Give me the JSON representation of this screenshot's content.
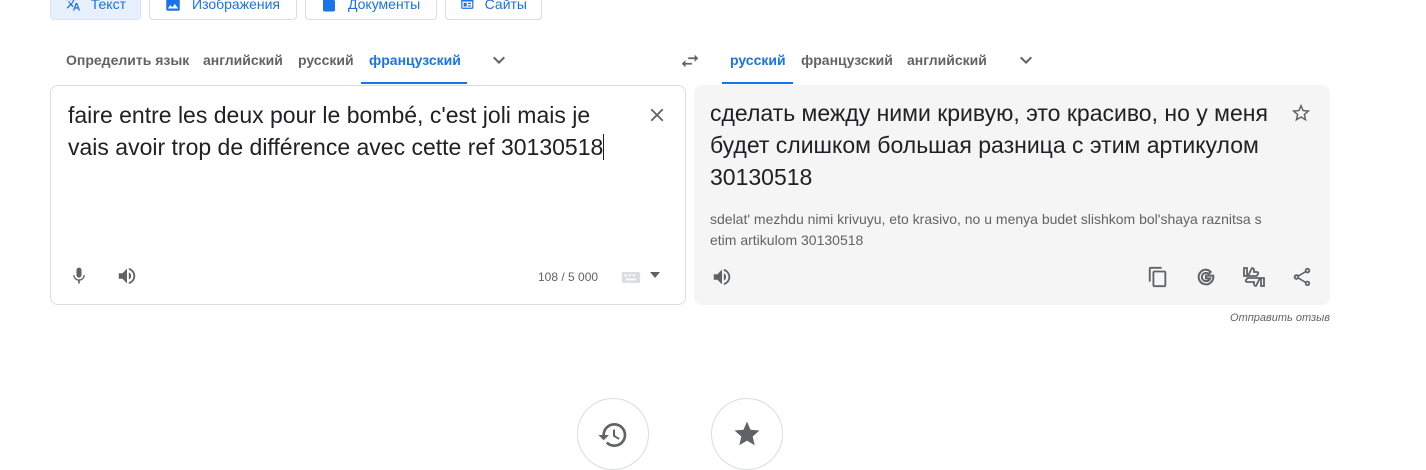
{
  "mode_tabs": [
    {
      "label": "Текст",
      "icon": "translate-icon",
      "active": true
    },
    {
      "label": "Изображения",
      "icon": "image-icon",
      "active": false
    },
    {
      "label": "Документы",
      "icon": "document-icon",
      "active": false
    },
    {
      "label": "Сайты",
      "icon": "website-icon",
      "active": false
    }
  ],
  "source_languages": [
    "Определить язык",
    "английский",
    "русский",
    "французский"
  ],
  "source_selected": "французский",
  "target_languages": [
    "русский",
    "французский",
    "английский"
  ],
  "target_selected": "русский",
  "source": {
    "text": "faire entre les deux pour le bombé, c'est joli mais je vais avoir trop de différence avec cette ref 30130518",
    "char_count": "108 / 5 000"
  },
  "target": {
    "text": "сделать между ними кривую, это красиво, но у меня будет слишком большая разница с этим артикулом 30130518",
    "transliteration": "sdelat' mezhdu nimi krivuyu, eto krasivo, no u menya budet slishkom bol'shaya raznitsa s etim artikulom 30130518"
  },
  "feedback_link": "Отправить отзыв",
  "colors": {
    "accent": "#1a73e8",
    "text": "#202124",
    "muted": "#5f6368",
    "panel_bg": "#f5f5f5",
    "border": "#dadce0"
  },
  "bottom_buttons": [
    "history-icon",
    "saved-star-icon"
  ]
}
